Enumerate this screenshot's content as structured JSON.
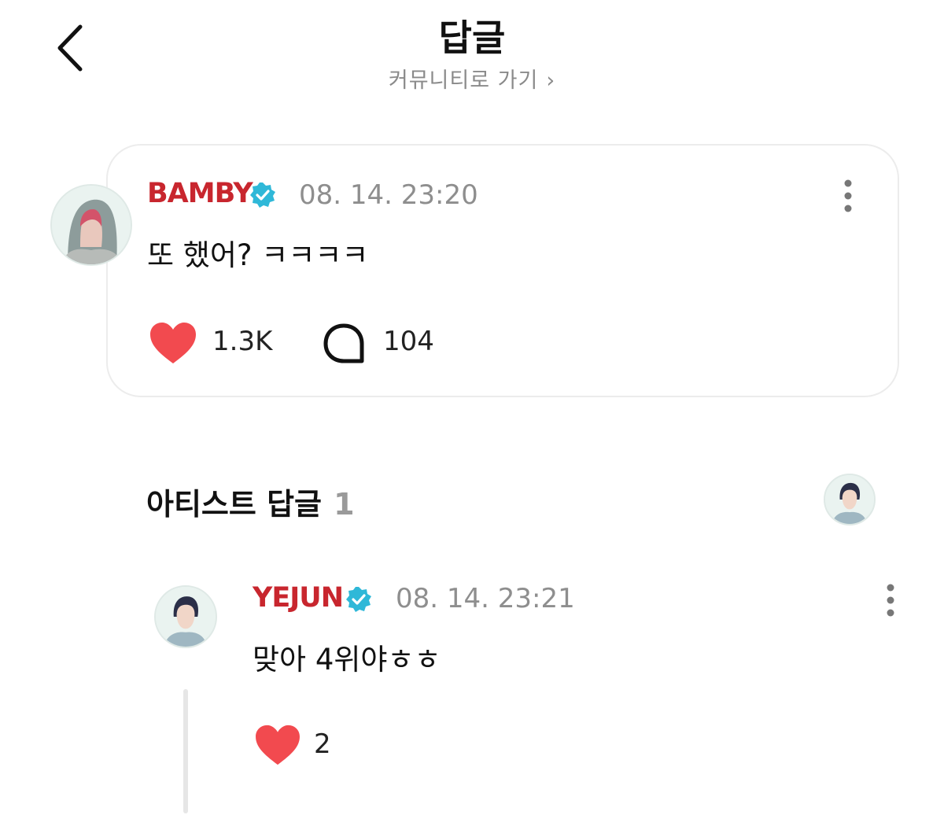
{
  "header": {
    "title": "답글",
    "subtitle": "커뮤니티로 가기",
    "subtitle_chevron": "›",
    "back_icon": "chevron-left-icon"
  },
  "post": {
    "author": "BAMBY",
    "author_color": "#c8262e",
    "verified_icon": "verified-badge-icon",
    "timestamp": "08. 14. 23:20",
    "text": "또 했어? ㅋㅋㅋㅋ",
    "likes": "1.3K",
    "comments": "104",
    "like_icon": "heart-icon",
    "comment_icon": "comment-bubble-icon",
    "more_icon": "more-vertical-icon"
  },
  "section": {
    "title": "아티스트 답글",
    "count": "1"
  },
  "reply": {
    "author": "YEJUN",
    "author_color": "#c8262e",
    "timestamp": "08. 14. 23:21",
    "text": "맞아 4위야ㅎㅎ",
    "likes": "2"
  },
  "colors": {
    "accent_red": "#c8262e",
    "heart": "#f24a4f",
    "verified": "#2fb8d8"
  }
}
